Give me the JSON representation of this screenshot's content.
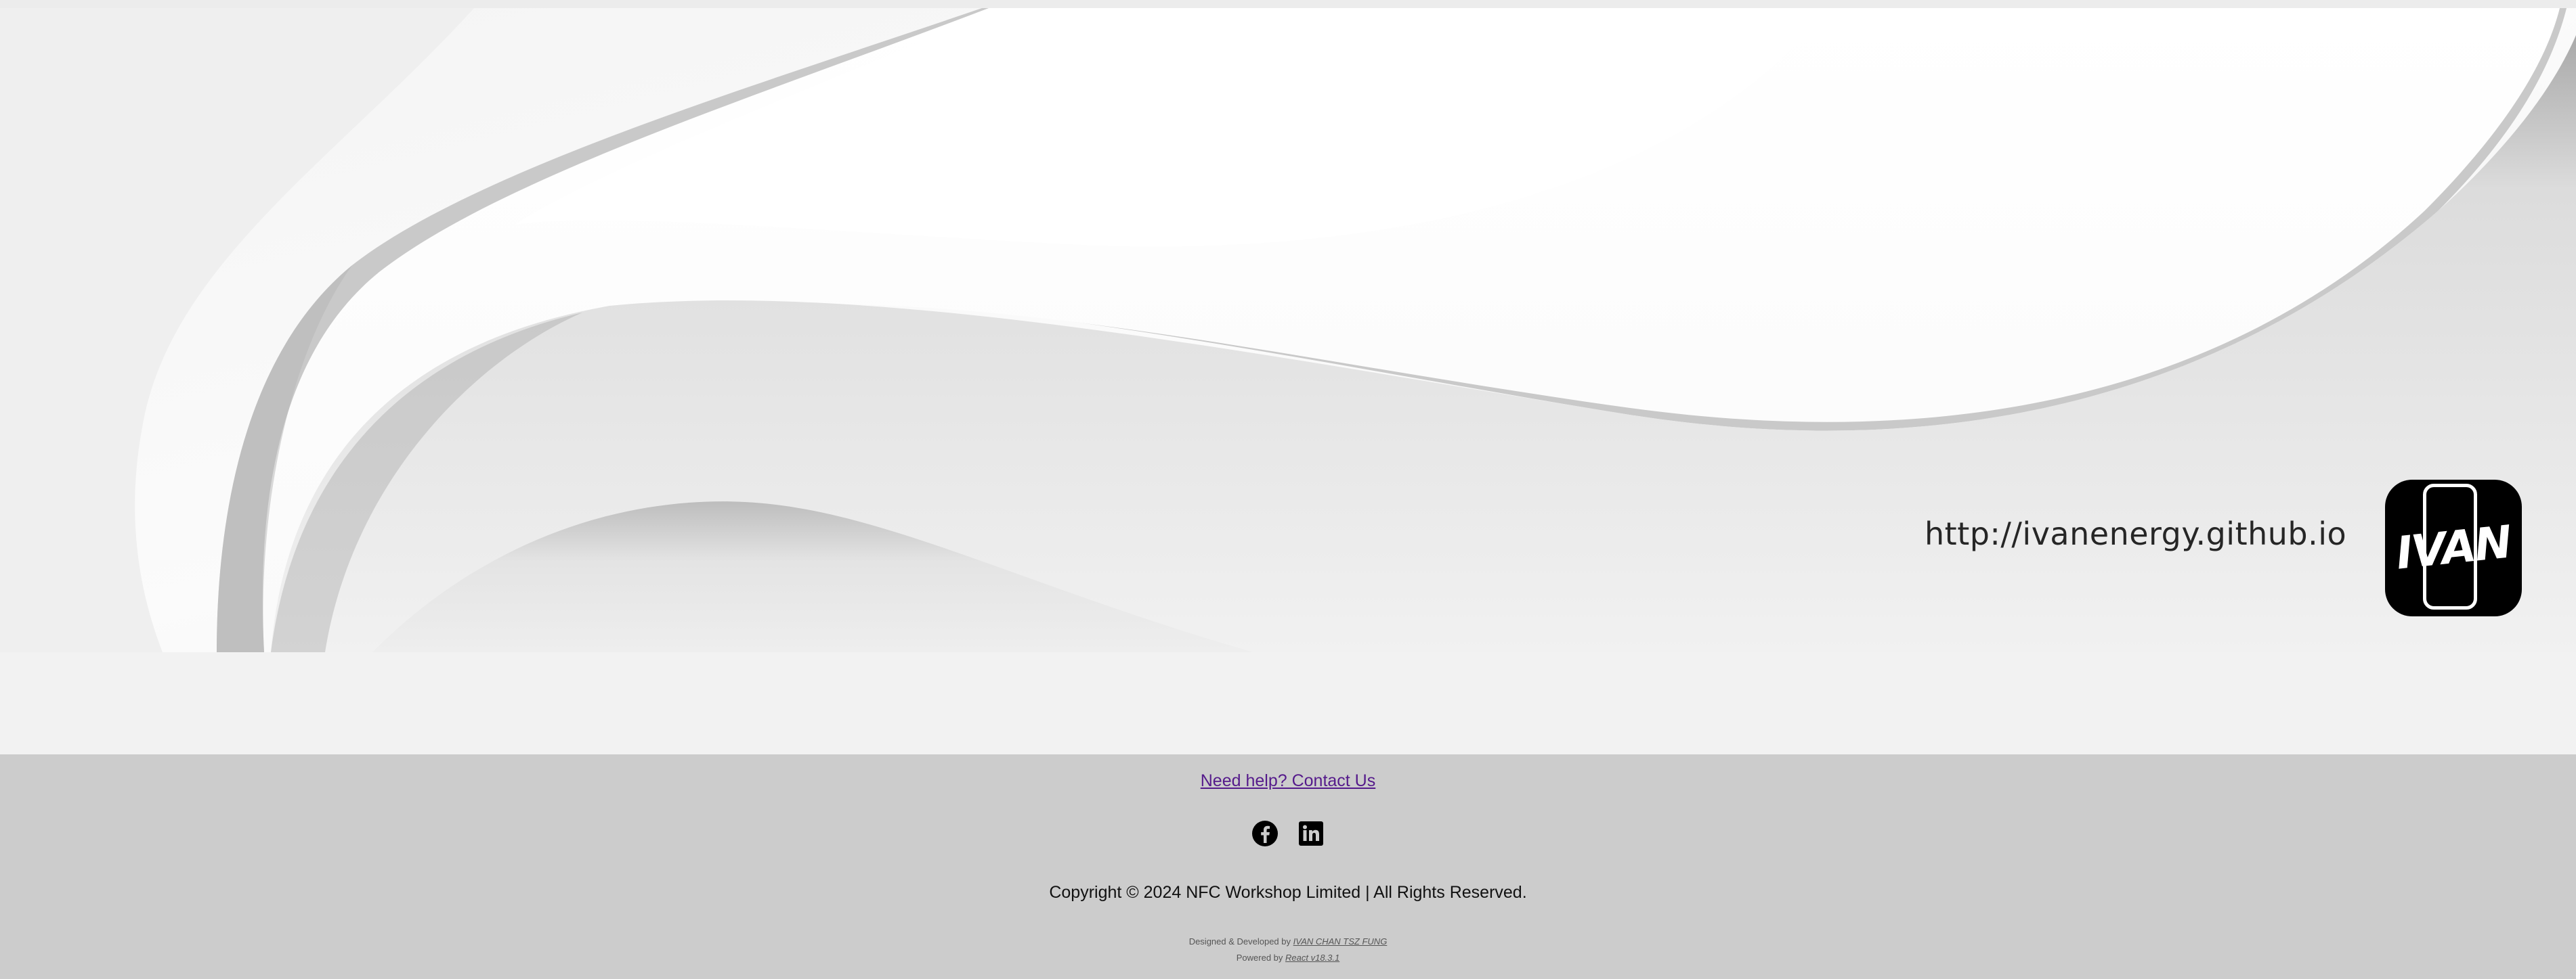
{
  "banner": {
    "url_text": "http://ivanenergy.github.io",
    "logo_text": "IVAN"
  },
  "footer": {
    "contact_link": "Need help? Contact Us",
    "social_icons": [
      "facebook-icon",
      "linkedin-icon"
    ],
    "copyright": "Copyright © 2024 NFC Workshop Limited | All Rights Reserved.",
    "designed_prefix": "Designed & Developed by ",
    "designer_name": "IVAN CHAN TSZ FUNG",
    "powered_prefix": "Powered by ",
    "powered_name": "React v18.3.1"
  },
  "colors": {
    "page_bg": "#f2f2f2",
    "footer_bg": "#cccccc",
    "link_visited": "#551a8b",
    "logo_bg": "#000000"
  }
}
